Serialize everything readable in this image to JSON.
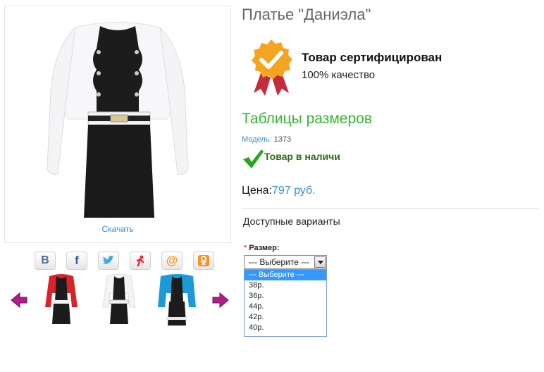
{
  "product": {
    "title": "Платье \"Даниэла\"",
    "download_label": "Скачать",
    "certified_title": "Товар сертифицирован",
    "certified_subtitle": "100% качество",
    "size_tables_link": "Таблицы размеров",
    "model_label": "Модель:",
    "model_value": "1373",
    "stock_status": "Товар в наличи",
    "price_label": "Цена:",
    "price_value": "797 руб."
  },
  "share": {
    "icons": [
      "vk-icon",
      "facebook-icon",
      "twitter-icon",
      "moimir-icon",
      "mailru-icon",
      "odnoklassniki-icon"
    ]
  },
  "variants": {
    "title": "Доступные варианты",
    "size_label": "Размер:",
    "required_mark": "*",
    "selected": "--- Выберите ---",
    "options": [
      "--- Выберите ---",
      "38р.",
      "36р.",
      "44р.",
      "42р.",
      "40р."
    ]
  },
  "colors": {
    "accent_green": "#38b535",
    "link_blue": "#3a8fc7",
    "selected_option": "#3399ff"
  }
}
